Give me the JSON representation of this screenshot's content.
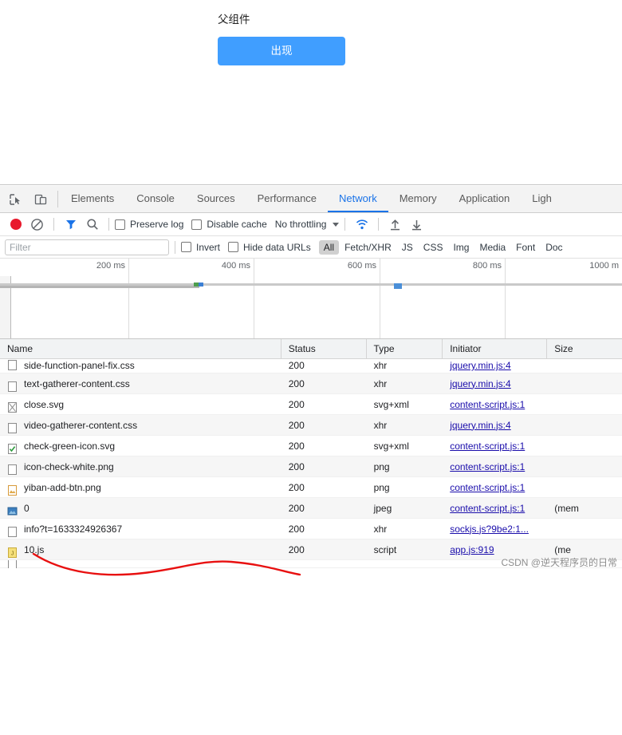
{
  "page": {
    "heading": "父组件",
    "button_label": "出现",
    "button_color": "#409eff"
  },
  "devtools": {
    "tabs": [
      {
        "label": "Elements",
        "active": false
      },
      {
        "label": "Console",
        "active": false
      },
      {
        "label": "Sources",
        "active": false
      },
      {
        "label": "Performance",
        "active": false
      },
      {
        "label": "Network",
        "active": true
      },
      {
        "label": "Memory",
        "active": false
      },
      {
        "label": "Application",
        "active": false
      },
      {
        "label": "Ligh",
        "active": false
      }
    ],
    "toolbar": {
      "record_title": "record-button",
      "clear_title": "clear-button",
      "filter_title": "filter-button",
      "search_title": "search-button",
      "preserve_log_label": "Preserve log",
      "preserve_log_checked": false,
      "disable_cache_label": "Disable cache",
      "disable_cache_checked": false,
      "throttling_label": "No throttling",
      "import_title": "import-har",
      "export_title": "export-har"
    },
    "filter_bar": {
      "filter_placeholder": "Filter",
      "invert_label": "Invert",
      "invert_checked": false,
      "hide_data_urls_label": "Hide data URLs",
      "hide_data_urls_checked": false,
      "types": [
        {
          "label": "All",
          "active": true
        },
        {
          "label": "Fetch/XHR",
          "active": false
        },
        {
          "label": "JS",
          "active": false
        },
        {
          "label": "CSS",
          "active": false
        },
        {
          "label": "Img",
          "active": false
        },
        {
          "label": "Media",
          "active": false
        },
        {
          "label": "Font",
          "active": false
        },
        {
          "label": "Doc",
          "active": false
        }
      ]
    },
    "overview": {
      "ticks": [
        "200 ms",
        "400 ms",
        "600 ms",
        "800 ms",
        "1000 m"
      ]
    },
    "table": {
      "columns": [
        "Name",
        "Status",
        "Type",
        "Initiator",
        "Size"
      ],
      "rows": [
        {
          "icon": "doc-icon",
          "name": "side-function-panel-fix.css",
          "status": "200",
          "type": "xhr",
          "initiator": "jquery.min.js:4",
          "size": ""
        },
        {
          "icon": "doc-icon",
          "name": "text-gatherer-content.css",
          "status": "200",
          "type": "xhr",
          "initiator": "jquery.min.js:4",
          "size": ""
        },
        {
          "icon": "svg-icon",
          "name": "close.svg",
          "status": "200",
          "type": "svg+xml",
          "initiator": "content-script.js:1",
          "size": ""
        },
        {
          "icon": "doc-icon",
          "name": "video-gatherer-content.css",
          "status": "200",
          "type": "xhr",
          "initiator": "jquery.min.js:4",
          "size": ""
        },
        {
          "icon": "check-icon",
          "name": "check-green-icon.svg",
          "status": "200",
          "type": "svg+xml",
          "initiator": "content-script.js:1",
          "size": ""
        },
        {
          "icon": "doc-icon",
          "name": "icon-check-white.png",
          "status": "200",
          "type": "png",
          "initiator": "content-script.js:1",
          "size": ""
        },
        {
          "icon": "img-icon",
          "name": "yiban-add-btn.png",
          "status": "200",
          "type": "png",
          "initiator": "content-script.js:1",
          "size": ""
        },
        {
          "icon": "photo-icon",
          "name": "0",
          "status": "200",
          "type": "jpeg",
          "initiator": "content-script.js:1",
          "size": "(mem"
        },
        {
          "icon": "doc-icon",
          "name": "info?t=1633324926367",
          "status": "200",
          "type": "xhr",
          "initiator": "sockjs.js?9be2:1...",
          "size": ""
        },
        {
          "icon": "js-icon",
          "name": "10.js",
          "status": "200",
          "type": "script",
          "initiator": "app.js:919",
          "size": "(me"
        }
      ]
    }
  },
  "watermark": "CSDN @逆天程序员的日常"
}
